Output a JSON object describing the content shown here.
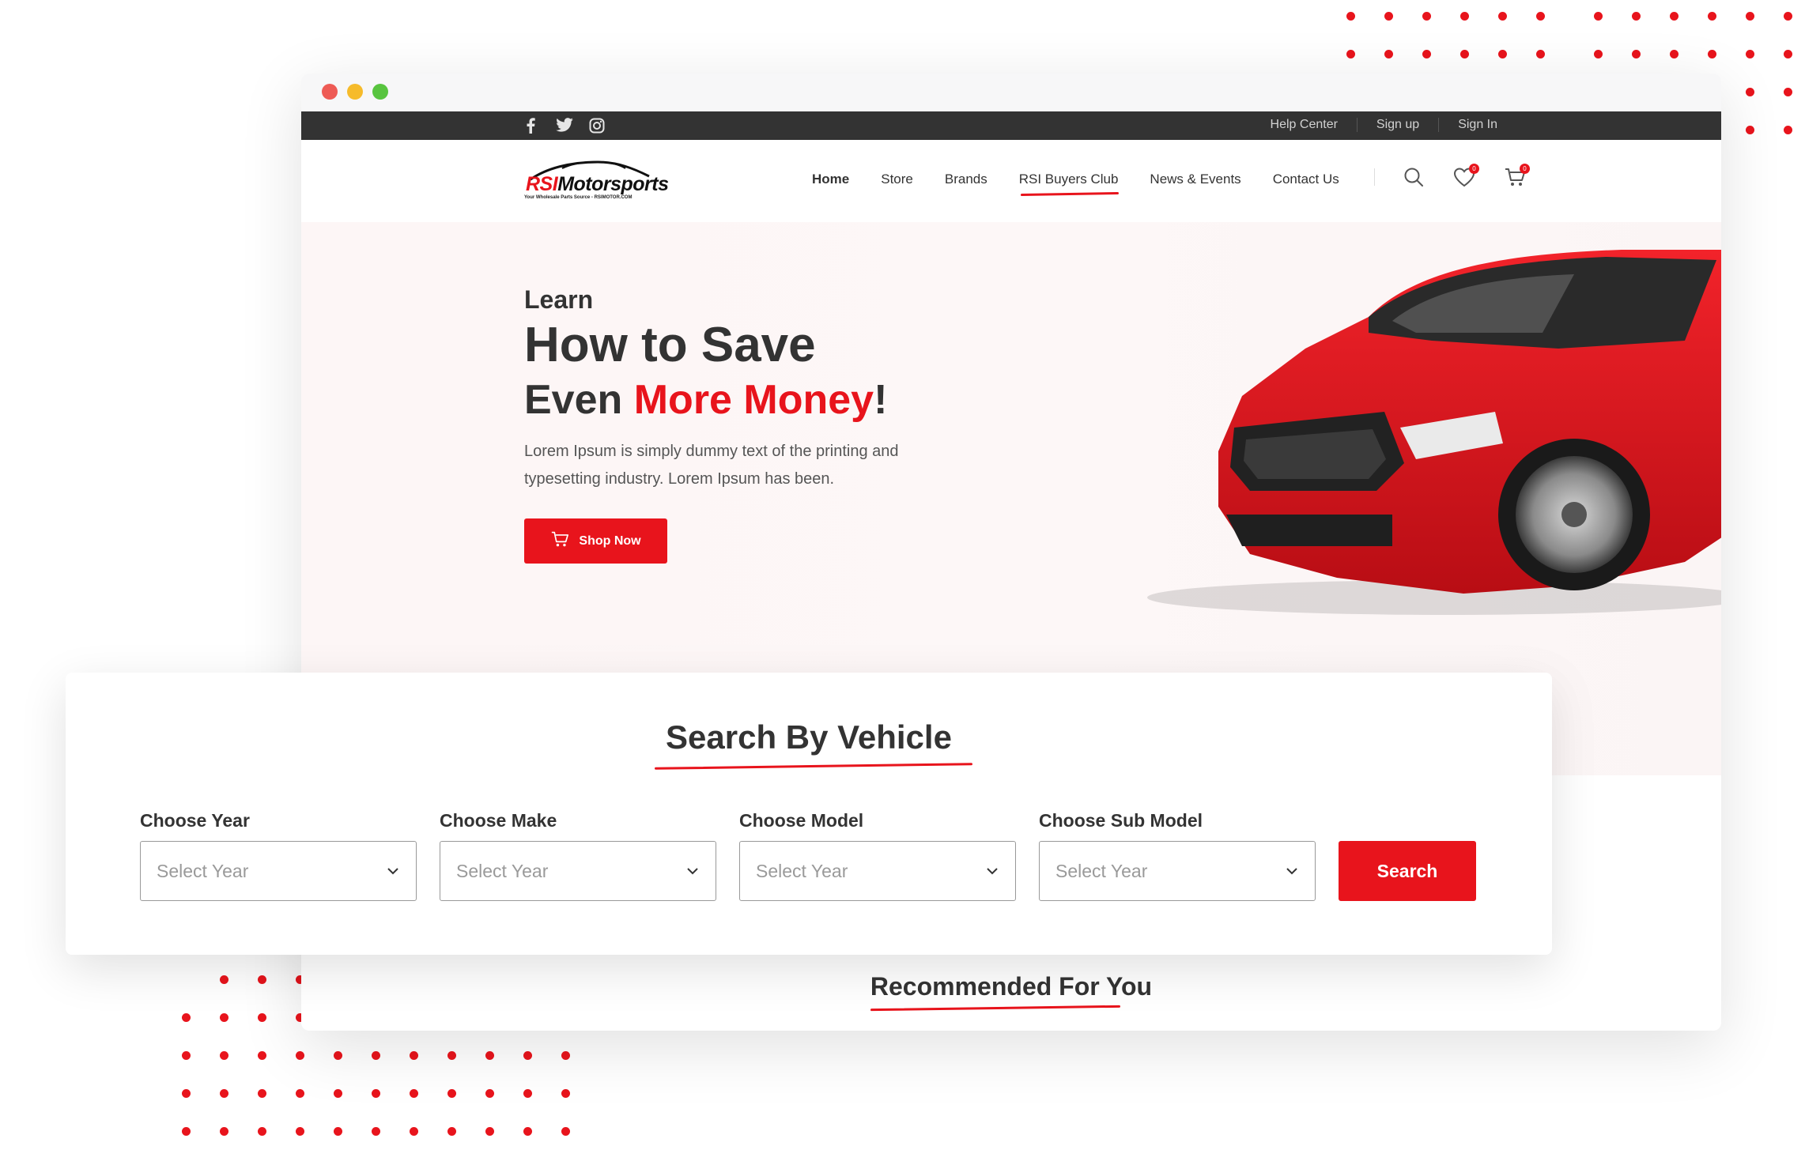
{
  "colors": {
    "accent": "#e8141c",
    "topbar": "#333333",
    "text": "#333333"
  },
  "topbar": {
    "social_icons": [
      "facebook-icon",
      "twitter-icon",
      "instagram-icon"
    ],
    "links": [
      "Help Center",
      "Sign up",
      "Sign In"
    ]
  },
  "logo": {
    "brand_prefix": "RSI",
    "brand_suffix": "Motorsports",
    "tagline": "Your Wholesale Parts Source - RSIMOTOR.COM"
  },
  "nav": {
    "items": [
      "Home",
      "Store",
      "Brands",
      "RSI Buyers Club",
      "News & Events",
      "Contact Us"
    ],
    "active": "Home",
    "wishlist_count": "0",
    "cart_count": "0"
  },
  "hero": {
    "kicker": "Learn",
    "title_line1": "How to Save",
    "title_line2_prefix": "Even ",
    "title_line2_highlight": "More Money",
    "title_line2_suffix": "!",
    "body": "Lorem Ipsum is simply dummy text of the printing and typesetting industry. Lorem Ipsum has been.",
    "cta_label": "Shop Now"
  },
  "search_vehicle": {
    "title": "Search By Vehicle",
    "fields": [
      {
        "label": "Choose Year",
        "placeholder": "Select Year"
      },
      {
        "label": "Choose Make",
        "placeholder": "Select Year"
      },
      {
        "label": "Choose Model",
        "placeholder": "Select Year"
      },
      {
        "label": "Choose Sub Model",
        "placeholder": "Select Year"
      }
    ],
    "button_label": "Search"
  },
  "recommended": {
    "title": "Recommended For You"
  }
}
